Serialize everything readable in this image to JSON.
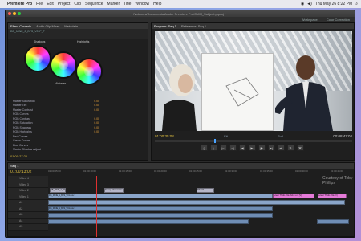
{
  "menubar": {
    "app_name": "Premiere Pro",
    "items": [
      "File",
      "Edit",
      "Project",
      "Clip",
      "Sequence",
      "Marker",
      "Title",
      "Window",
      "Help"
    ],
    "clock": "Thu May 26  8:22 PM"
  },
  "window": {
    "title": "/Volumes/Documents/Adobe Premiere Pro/CMM_Subject.prproj *",
    "workspace_label": "Workspace:",
    "workspace_value": "Color Correction"
  },
  "effect_controls": {
    "tabs": [
      "Effect Controls",
      "Audio Clip Mixer",
      "Metadata"
    ],
    "clip_path": "DB_MINE_2_BFS_V01P_F",
    "wheel_labels": {
      "shadows": "Shadows",
      "midtones": "Midtones",
      "highlights": "Highlights"
    },
    "properties": [
      {
        "label": "Master Saturation",
        "value": "0.00"
      },
      {
        "label": "Master Tint",
        "value": "0.00"
      },
      {
        "label": "Master Contrast",
        "value": "0.00"
      },
      {
        "label": "RGB Curves",
        "value": ""
      },
      {
        "label": "RGB Contrast",
        "value": "0.00"
      },
      {
        "label": "RGB Saturation",
        "value": "0.00"
      },
      {
        "label": "RGB Shadows",
        "value": "0.00"
      },
      {
        "label": "RGB Highlights",
        "value": "0.00"
      },
      {
        "label": "Red Curves",
        "value": ""
      },
      {
        "label": "Green Curves",
        "value": ""
      },
      {
        "label": "Blue Curves",
        "value": ""
      },
      {
        "label": "Master Shadow Adjust",
        "value": ""
      }
    ],
    "bottom_timecode": "01:00:27:26"
  },
  "program_monitor": {
    "tabs": [
      "Program: Seq 1",
      "Reference: Seq 1"
    ],
    "timecode_left": "01:00:35:08",
    "fit_label": "Fit",
    "quality_label": "Full",
    "timecode_right": "00:08:47:04",
    "transport": [
      "{",
      "}",
      "|<",
      "<|",
      "◀",
      "▶",
      "|▶",
      "▶|",
      "⇄",
      "⇅",
      "⌘"
    ]
  },
  "timeline": {
    "tab": "Seq 1",
    "timecode": "01:00:13:02",
    "ruler_ticks": [
      "01:00:05:00",
      "01:00:10:00",
      "01:00:15:00",
      "01:00:20:00",
      "01:00:25:00",
      "01:00:30:00",
      "01:00:35:00",
      "01:00:40:00",
      "01:00:45:00"
    ],
    "credit": "Courtesy of Toby Phillips",
    "tracks": [
      "Video 4",
      "Video 3",
      "Video 2",
      "Video 1",
      "A1",
      "A2",
      "A3",
      "A4",
      "A5"
    ],
    "clips": {
      "title_a": "DB_MINE_2_BFS_1.mov",
      "title_b": "Nancy Alfonso Mac",
      "title_c": "Title 02",
      "pink_a": "Lower Thirds Title 8x13 s.ml [V]",
      "pink_b": "Lower Thirds Title [V]",
      "v1": "DB_MINE_1_BFS_V01.mov",
      "a1": "DB_MINE_1_BFS_V01.mov"
    }
  },
  "colors": {
    "accent_timecode": "#e0c040",
    "playhead": "#e03030",
    "video_clip": "#8aa5c9",
    "audio_clip": "#6f8db4",
    "graphic_clip": "#e57ad8"
  }
}
